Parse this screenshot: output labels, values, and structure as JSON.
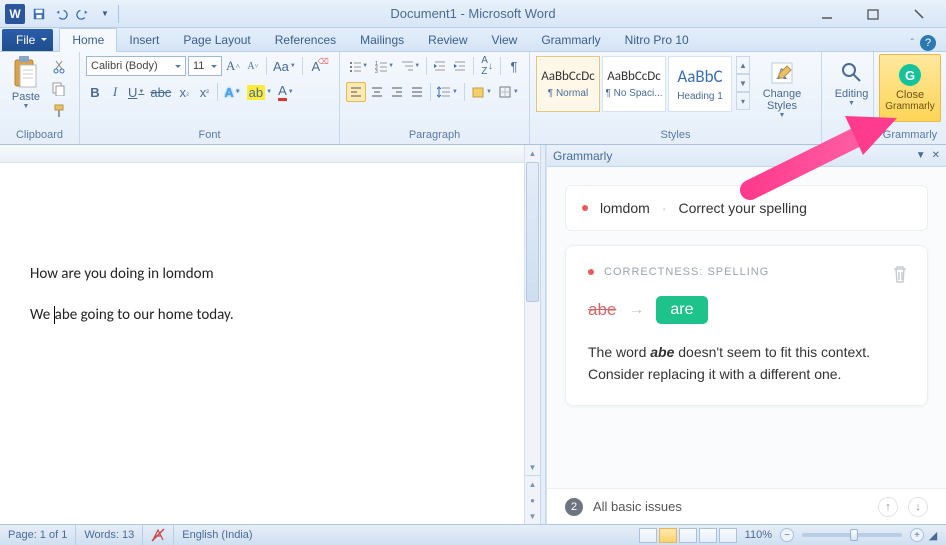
{
  "title": "Document1 - Microsoft Word",
  "tabs": {
    "file": "File",
    "items": [
      "Home",
      "Insert",
      "Page Layout",
      "References",
      "Mailings",
      "Review",
      "View",
      "Grammarly",
      "Nitro Pro 10"
    ],
    "active": "Home"
  },
  "ribbon": {
    "clipboard": {
      "label": "Clipboard",
      "paste": "Paste"
    },
    "font": {
      "label": "Font",
      "name": "Calibri (Body)",
      "size": "11"
    },
    "paragraph": {
      "label": "Paragraph"
    },
    "styles": {
      "label": "Styles",
      "items": [
        {
          "preview": "AaBbCcDc",
          "caption": "¶ Normal",
          "selected": true,
          "color": "#333",
          "fs": "13px"
        },
        {
          "preview": "AaBbCcDc",
          "caption": "¶ No Spaci...",
          "selected": false,
          "color": "#333",
          "fs": "13px"
        },
        {
          "preview": "AaBbC",
          "caption": "Heading 1",
          "selected": false,
          "color": "#3b6fb5",
          "fs": "17px"
        }
      ],
      "change": "Change Styles"
    },
    "editing": {
      "label": "Editing"
    },
    "grammarly": {
      "label": "Grammarly",
      "btn1": "Close",
      "btn2": "Grammarly"
    }
  },
  "document": {
    "p1": "How are you doing in lomdom",
    "p2_a": "We ",
    "p2_b": "abe going to our home today."
  },
  "grammarly_pane": {
    "title": "Grammarly",
    "card1_word": "lomdom",
    "card1_msg": "Correct your spelling",
    "card2_tag": "CORRECTNESS: SPELLING",
    "card2_from": "abe",
    "card2_to": "are",
    "card2_expl_a": "The word ",
    "card2_expl_em": "abe",
    "card2_expl_b": " doesn't seem to fit this context. Consider replacing it with a different one.",
    "footer_count": "2",
    "footer_text": "All basic issues"
  },
  "statusbar": {
    "page": "Page: 1 of 1",
    "words": "Words: 13",
    "lang": "English (India)",
    "zoom": "110%"
  }
}
